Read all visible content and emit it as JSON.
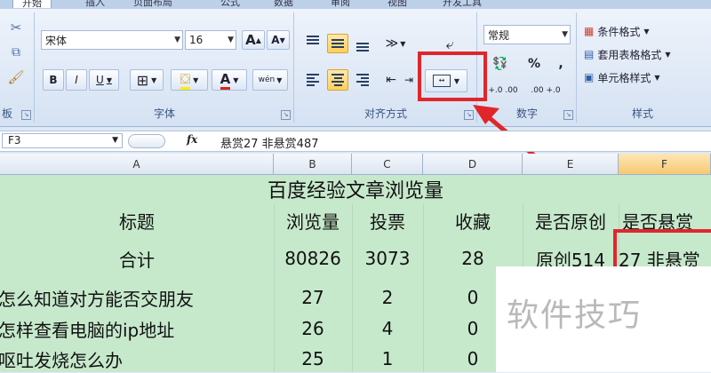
{
  "ribbon": {
    "tabs": [
      "开始",
      "插入",
      "页面布局",
      "公式",
      "数据",
      "审阅",
      "视图",
      "开发工具"
    ],
    "font": {
      "name": "宋体",
      "size": "16",
      "grow": "A",
      "shrink": "A",
      "bold": "B",
      "italic": "I",
      "underline": "U",
      "font_color_glyph": "A",
      "phonetic": "wén",
      "label": "字体"
    },
    "alignment": {
      "label": "对齐方式"
    },
    "number": {
      "format": "常规",
      "percent": "%",
      "comma": ",",
      "inc_decimal": "+.0 .00",
      "dec_decimal": ".00 +.0",
      "label": "数字"
    },
    "styles": {
      "conditional": "条件格式",
      "table": "套用表格格式",
      "cell": "单元格样式",
      "label": "样式"
    },
    "clipboard_label": "板"
  },
  "formula_bar": {
    "name_box": "F3",
    "fx": "fx",
    "content": "悬赏27  非悬赏487"
  },
  "sheet": {
    "columns": [
      "A",
      "B",
      "C",
      "D",
      "E",
      "F"
    ],
    "selected_column": "F",
    "title": "百度经验文章浏览量",
    "headers": [
      "标题",
      "浏览量",
      "投票",
      "收藏",
      "是否原创",
      "是否悬赏"
    ],
    "total": [
      "合计",
      "80826",
      "3073",
      "28",
      "原创514",
      "27  非悬赏"
    ],
    "rows": [
      [
        "怎么知道对方能否交朋友",
        "27",
        "2",
        "0"
      ],
      [
        "怎样查看电脑的ip地址",
        "26",
        "4",
        "0"
      ],
      [
        "呕吐发烧怎么办",
        "25",
        "1",
        "0"
      ]
    ]
  },
  "watermark": "软件技巧",
  "colors": {
    "highlight": "#e0262b",
    "grid_fill": "#c6e9cc"
  }
}
